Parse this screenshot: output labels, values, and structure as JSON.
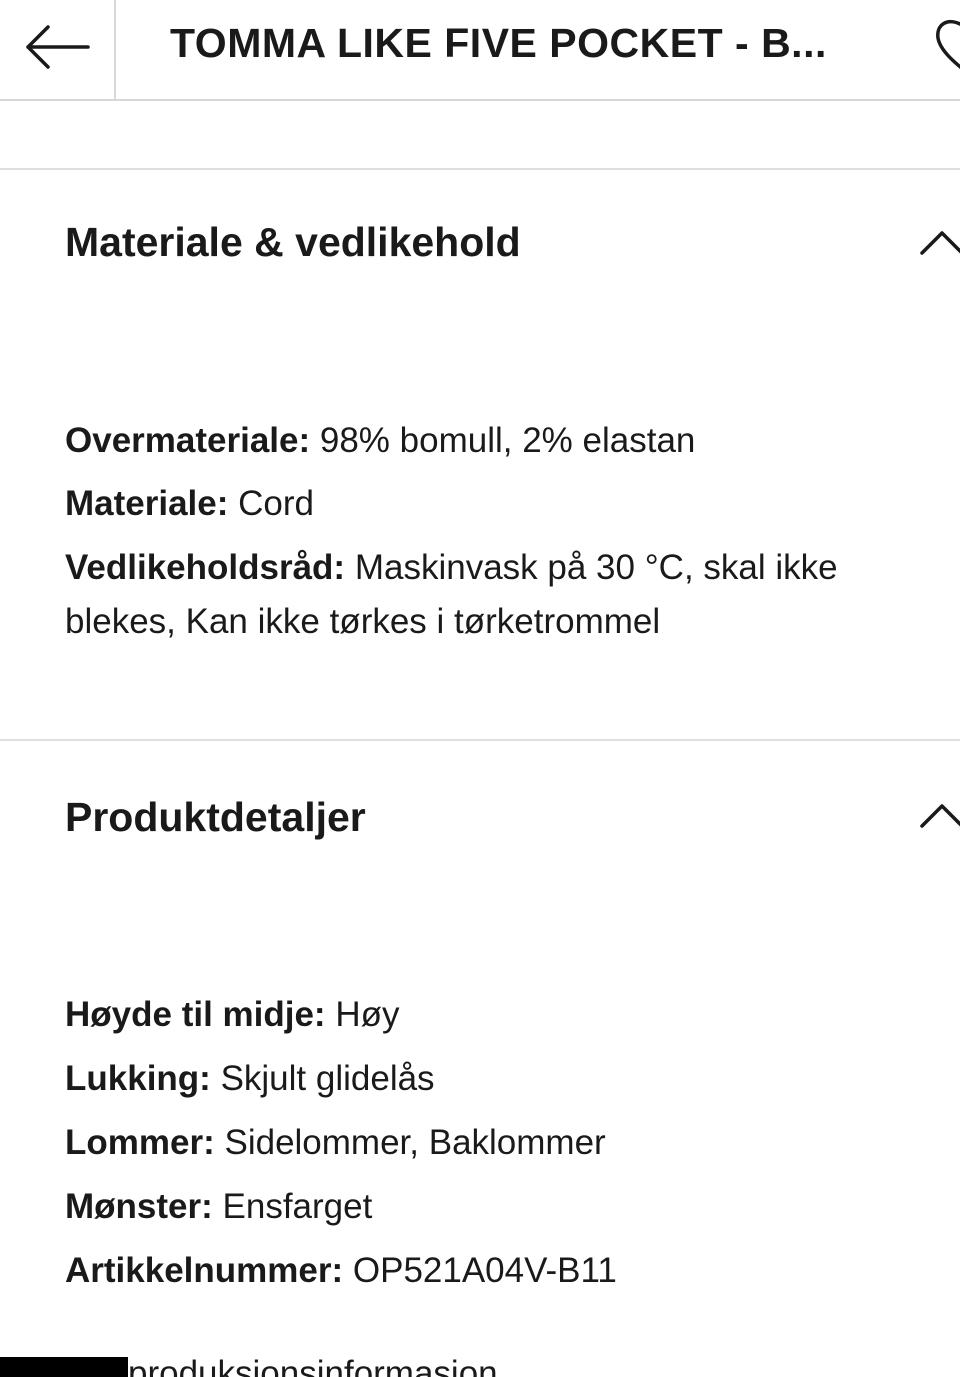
{
  "header": {
    "back_icon": "arrow-left-icon",
    "title": "TOMMA LIKE FIVE POCKET - B...",
    "wishlist_icon": "heart-icon"
  },
  "sections": [
    {
      "title": "Materiale & vedlikehold",
      "toggle_icon": "chevron-up-icon",
      "details": [
        {
          "label": "Overmateriale:",
          "value": "98% bomull, 2% elastan"
        },
        {
          "label": "Materiale:",
          "value": "Cord"
        },
        {
          "label": "Vedlikeholdsråd:",
          "value": "Maskinvask på 30 °C, skal ikke blekes, Kan ikke tørkes i tørketrommel"
        }
      ]
    },
    {
      "title": "Produktdetaljer",
      "toggle_icon": "chevron-up-icon",
      "details": [
        {
          "label": "Høyde til midje:",
          "value": "Høy"
        },
        {
          "label": "Lukking:",
          "value": "Skjult glidelås"
        },
        {
          "label": "Lommer:",
          "value": "Sidelommer, Baklommer"
        },
        {
          "label": "Mønster:",
          "value": "Ensfarget"
        },
        {
          "label": "Artikkelnummer:",
          "value": "OP521A04V-B11"
        }
      ]
    }
  ],
  "footer": {
    "partial_text": "produksjonsinformasjon"
  }
}
